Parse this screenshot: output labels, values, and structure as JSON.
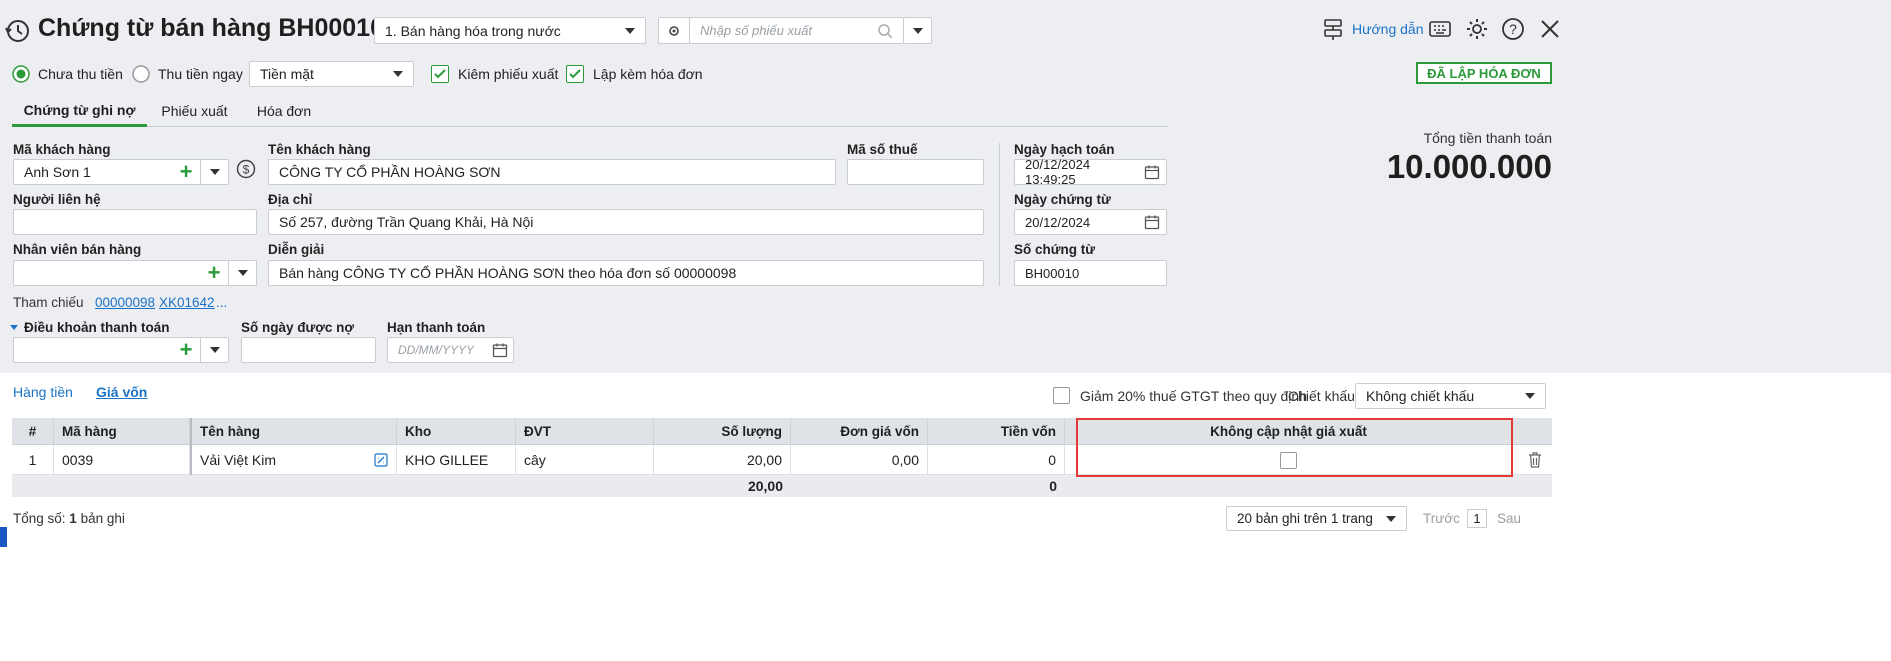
{
  "header": {
    "title": "Chứng từ bán hàng BH00010",
    "type_select": "1. Bán hàng hóa trong nước",
    "search_placeholder": "Nhập số phiếu xuất",
    "help_label": "Hướng dẫn"
  },
  "options": {
    "unpaid_label": "Chưa thu tiền",
    "paid_label": "Thu tiền ngay",
    "payment_method": "Tiền mặt",
    "export_label": "Kiêm phiếu xuất",
    "invoice_label": "Lập kèm hóa đơn",
    "status_badge": "ĐÃ LẬP HÓA ĐƠN",
    "unpaid_checked": true,
    "export_checked": true,
    "invoice_checked": true
  },
  "tabs": [
    "Chứng từ ghi nợ",
    "Phiếu xuất",
    "Hóa đơn"
  ],
  "form": {
    "customer_code_label": "Mã khách hàng",
    "customer_code": "Anh Sơn 1",
    "customer_name_label": "Tên khách hàng",
    "customer_name": "CÔNG TY CỔ PHẦN HOÀNG SƠN",
    "tax_code_label": "Mã số thuế",
    "tax_code": "",
    "contact_label": "Người liên hệ",
    "contact": "",
    "address_label": "Địa chỉ",
    "address": "Số 257, đường Trần Quang Khải, Hà Nội",
    "staff_label": "Nhân viên bán hàng",
    "staff": "",
    "description_label": "Diễn giải",
    "description": "Bán hàng CÔNG TY CỔ PHẦN HOÀNG SƠN theo hóa đơn số 00000098",
    "accounting_date_label": "Ngày hạch toán",
    "accounting_date": "20/12/2024 13:49:25",
    "voucher_date_label": "Ngày chứng từ",
    "voucher_date": "20/12/2024",
    "voucher_no_label": "Số chứng từ",
    "voucher_no": "BH00010",
    "reference_label": "Tham chiếu",
    "ref1": "00000098",
    "ref2": "XK01642",
    "ref_more": "...",
    "payment_terms_label": "Điều khoản thanh toán",
    "debt_days_label": "Số ngày được nợ",
    "due_date_label": "Hạn thanh toán",
    "due_date_placeholder": "DD/MM/YYYY"
  },
  "total": {
    "label": "Tổng tiền thanh toán",
    "value": "10.000.000"
  },
  "detail": {
    "tab_goods": "Hàng tiền",
    "tab_cost": "Giá vốn",
    "vat_reduce_label": "Giảm 20% thuế GTGT theo quy định",
    "discount_label": "Chiết khấu",
    "discount_value": "Không chiết khấu",
    "columns": [
      "#",
      "Mã hàng",
      "Tên hàng",
      "Kho",
      "ĐVT",
      "Số lượng",
      "Đơn giá vốn",
      "Tiền vốn",
      "Không cập nhật giá xuất"
    ],
    "rows": [
      {
        "no": "1",
        "code": "0039",
        "name": "Vải Việt Kim",
        "warehouse": "KHO GILLEE",
        "unit": "cây",
        "qty": "20,00",
        "unit_cost": "0,00",
        "cost": "0"
      }
    ],
    "sum_qty": "20,00",
    "sum_cost": "0",
    "total_records_prefix": "Tổng số:",
    "total_records_count": "1",
    "total_records_suffix": "bản ghi",
    "page_size": "20 bản ghi trên 1 trang",
    "prev": "Trước",
    "page": "1",
    "next": "Sau"
  },
  "colors": {
    "accent": "#2b9a3a",
    "highlight": "#e53935",
    "link": "#1a73c8"
  }
}
